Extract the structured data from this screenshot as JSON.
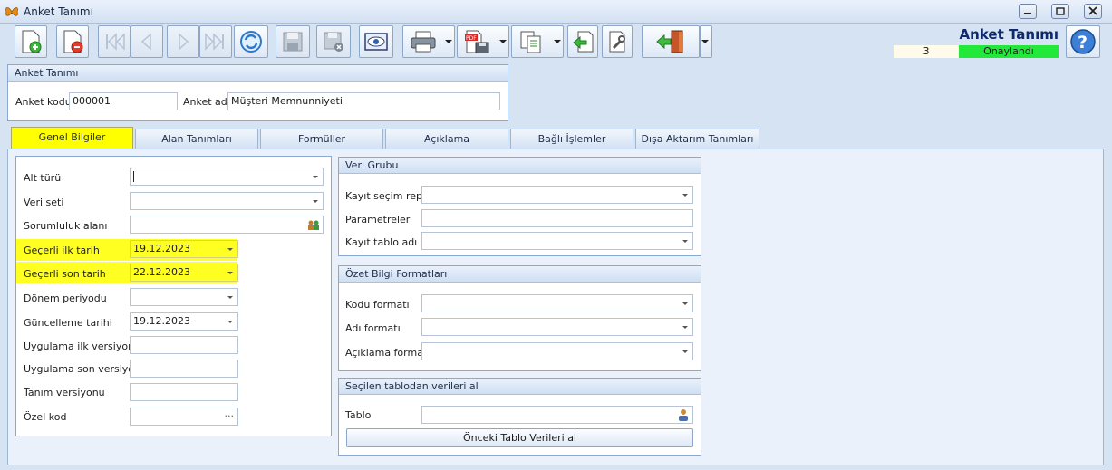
{
  "window": {
    "title": "Anket Tanımı"
  },
  "header": {
    "title": "Anket Tanımı",
    "count": "3",
    "status": "Onaylandı",
    "status_color": "#22e83a"
  },
  "toolbar": {
    "buttons": [
      {
        "name": "new-document-button",
        "icon": "document-add-icon"
      },
      {
        "name": "delete-document-button",
        "icon": "document-remove-icon"
      },
      {
        "name": "first-record-button",
        "icon": "skip-first-icon"
      },
      {
        "name": "previous-record-button",
        "icon": "previous-icon"
      },
      {
        "name": "next-record-button",
        "icon": "next-icon"
      },
      {
        "name": "last-record-button",
        "icon": "skip-last-icon"
      },
      {
        "name": "refresh-button",
        "icon": "refresh-icon"
      },
      {
        "name": "save-button",
        "icon": "save-icon"
      },
      {
        "name": "save-close-button",
        "icon": "save-close-icon"
      },
      {
        "name": "preview-button",
        "icon": "eye-icon"
      },
      {
        "name": "print-button",
        "icon": "printer-icon"
      },
      {
        "name": "export-pdf-button",
        "icon": "pdf-icon"
      },
      {
        "name": "copy-button",
        "icon": "copy-icon"
      },
      {
        "name": "back-button",
        "icon": "back-arrow-icon"
      },
      {
        "name": "settings-button",
        "icon": "wrench-icon"
      },
      {
        "name": "exit-button",
        "icon": "exit-door-icon"
      },
      {
        "name": "help-button",
        "icon": "help-icon"
      }
    ]
  },
  "anket": {
    "group_title": "Anket Tanımı",
    "code_label": "Anket kodu",
    "code_value": "000001",
    "name_label": "Anket adı",
    "name_value": "Müşteri Memnunniyeti"
  },
  "tabs": [
    {
      "label": "Genel Bilgiler",
      "active": true
    },
    {
      "label": "Alan Tanımları"
    },
    {
      "label": "Formüller"
    },
    {
      "label": "Açıklama"
    },
    {
      "label": "Bağlı İşlemler"
    },
    {
      "label": "Dışa Aktarım Tanımları"
    }
  ],
  "general": {
    "fields": [
      {
        "label": "Alt türü",
        "value": ""
      },
      {
        "label": "Veri seti",
        "value": ""
      },
      {
        "label": "Sorumluluk alanı",
        "value": ""
      },
      {
        "label": "Geçerli ilk tarih",
        "value": "19.12.2023"
      },
      {
        "label": "Geçerli son tarih",
        "value": "22.12.2023"
      },
      {
        "label": "Dönem periyodu",
        "value": ""
      },
      {
        "label": "Güncelleme tarihi",
        "value": "19.12.2023"
      },
      {
        "label": "Uygulama ilk versiyon",
        "value": ""
      },
      {
        "label": "Uygulama son versiyon",
        "value": ""
      },
      {
        "label": "Tanım versiyonu",
        "value": ""
      },
      {
        "label": "Özel kod",
        "value": "",
        "ellipsis": "···"
      }
    ]
  },
  "veri_grubu": {
    "title": "Veri Grubu",
    "fields": [
      {
        "label": "Kayıt seçim repo",
        "value": ""
      },
      {
        "label": "Parametreler",
        "value": ""
      },
      {
        "label": "Kayıt tablo adı",
        "value": ""
      }
    ]
  },
  "ozet": {
    "title": "Özet Bilgi Formatları",
    "fields": [
      {
        "label": "Kodu formatı",
        "value": ""
      },
      {
        "label": "Adı formatı",
        "value": ""
      },
      {
        "label": "Açıklama formatı",
        "value": ""
      }
    ]
  },
  "secilen": {
    "title": "Seçilen tablodan verileri al",
    "table_label": "Tablo",
    "table_value": "",
    "button_label": "Önceki Tablo Verileri al"
  },
  "highlight_color": "#ffff22"
}
